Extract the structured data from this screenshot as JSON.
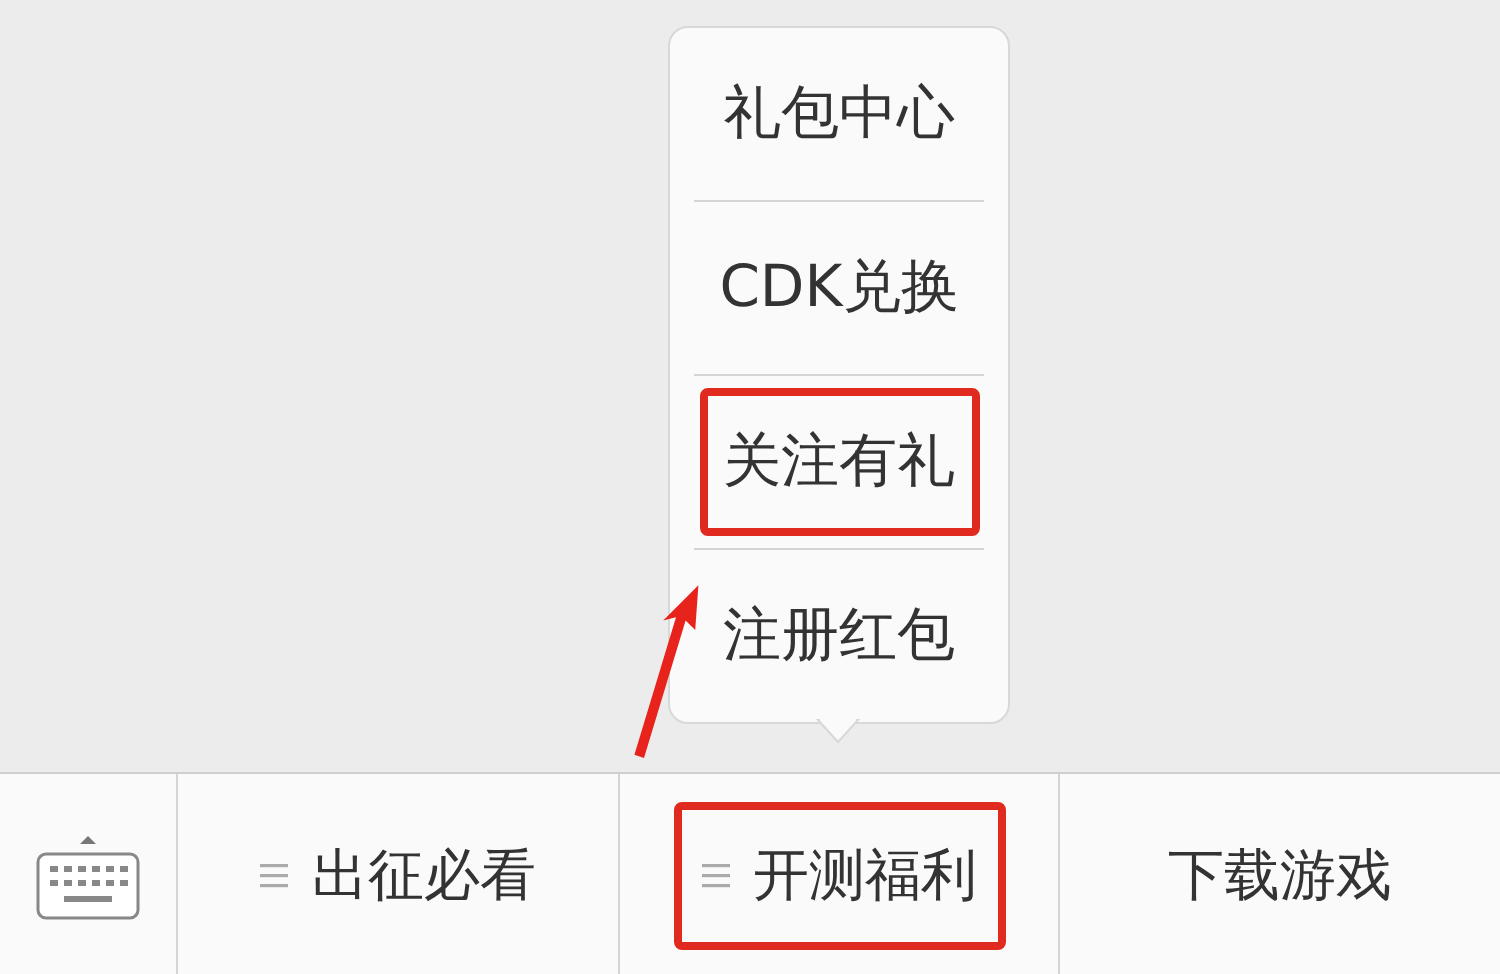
{
  "menu": {
    "items": [
      {
        "label": "礼包中心",
        "highlighted": false
      },
      {
        "label": "CDK兑换",
        "highlighted": false
      },
      {
        "label": "关注有礼",
        "highlighted": true
      },
      {
        "label": "注册红包",
        "highlighted": false
      }
    ]
  },
  "bottom_bar": {
    "tabs": [
      {
        "label": "出征必看",
        "has_menu": true,
        "highlighted": false
      },
      {
        "label": "开测福利",
        "has_menu": true,
        "highlighted": true
      },
      {
        "label": "下载游戏",
        "has_menu": false,
        "highlighted": false
      }
    ]
  }
}
